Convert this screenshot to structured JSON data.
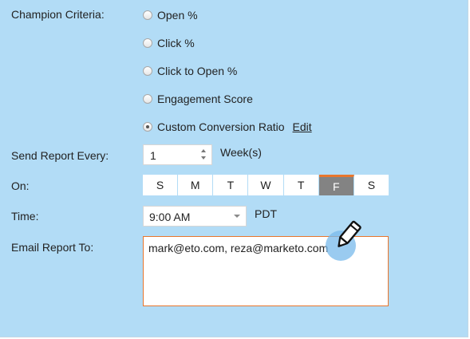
{
  "form": {
    "champion": {
      "label": "Champion Criteria:",
      "options": [
        {
          "label": "Open %",
          "selected": false
        },
        {
          "label": "Click %",
          "selected": false
        },
        {
          "label": "Click to Open %",
          "selected": false
        },
        {
          "label": "Engagement Score",
          "selected": false
        },
        {
          "label": "Custom Conversion Ratio",
          "selected": true
        }
      ],
      "edit_link": "Edit"
    },
    "send_every": {
      "label": "Send Report Every:",
      "value": "1",
      "unit": "Week(s)"
    },
    "on": {
      "label": "On:",
      "days": [
        "S",
        "M",
        "T",
        "W",
        "T",
        "F",
        "S"
      ],
      "selected_index": 5
    },
    "time": {
      "label": "Time:",
      "value": "9:00 AM",
      "timezone": "PDT"
    },
    "email": {
      "label": "Email Report To:",
      "value": "mark@eto.com, reza@marketo.com"
    }
  },
  "icons": {
    "cursor": "pencil-icon",
    "stepper": "stepper-arrows-icon",
    "select": "chevron-down-icon"
  },
  "colors": {
    "panel_background": "#b2dcf6",
    "selected_day": "#838383",
    "accent": "#e8762d"
  }
}
